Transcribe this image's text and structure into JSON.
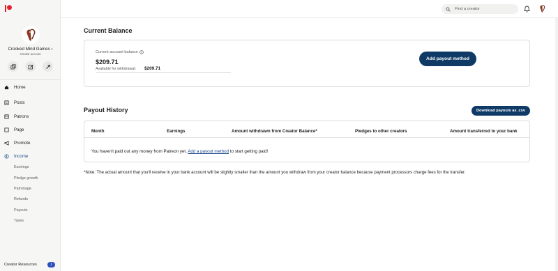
{
  "sidebar": {
    "creator_name": "Crooked Mind Games ›",
    "creator_subtitle": "Creator account",
    "quick_actions": [
      "switch-account-icon",
      "edit-icon",
      "share-icon"
    ],
    "nav": [
      {
        "label": "Home",
        "icon": "home-icon"
      },
      {
        "label": "Posts",
        "icon": "posts-icon"
      },
      {
        "label": "Patrons",
        "icon": "patrons-icon"
      },
      {
        "label": "Page",
        "icon": "page-icon"
      },
      {
        "label": "Promote",
        "icon": "megaphone-icon"
      },
      {
        "label": "Income",
        "icon": "income-icon",
        "active": true
      }
    ],
    "income_sub": [
      "Earnings",
      "Pledge growth",
      "Patronage",
      "Refunds",
      "Payouts",
      "Taxes"
    ],
    "resources_label": "Creator Resources",
    "resources_badge": "1"
  },
  "topbar": {
    "search_placeholder": "Find a creator"
  },
  "balance": {
    "title": "Current Balance",
    "label": "Current account balance",
    "value": "$209.71",
    "available_label": "Available for withdrawal:",
    "available_value": "$209.71",
    "button": "Add payout method"
  },
  "history": {
    "title": "Payout History",
    "download_button": "Download payouts as .csv",
    "columns": [
      "Month",
      "Earnings",
      "Amount withdrawn from Creator Balance*",
      "Pledges to other creators",
      "Amount transferred to your bank"
    ],
    "empty_prefix": "You haven't paid out any money from Patreon yet.",
    "empty_link": "Add a payout method",
    "empty_suffix": "to start getting paid!"
  },
  "note": "*Note: The actual amount that you'll receive in your bank account will be slightly smaller than the amount you withdraw from your creator balance because payment processors charge fees for the transfer.",
  "colors": {
    "primary": "#0f3a66",
    "active_nav": "#1e4b8c",
    "sidebar_bg": "#f6f6f5",
    "badge": "#2d4fbe",
    "brand": "#e4202f"
  }
}
